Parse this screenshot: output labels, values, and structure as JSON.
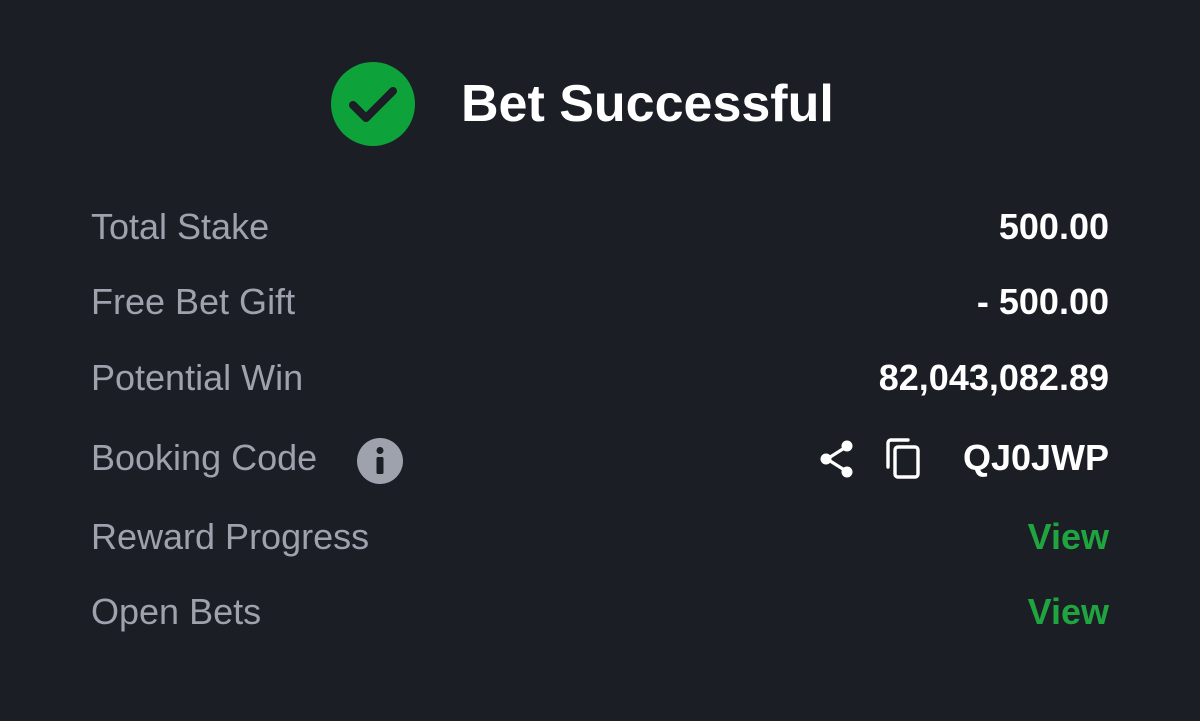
{
  "header": {
    "title": "Bet Successful",
    "icon": "check-circle-icon",
    "icon_color": "#0ea33a"
  },
  "summary": {
    "total_stake_label": "Total Stake",
    "total_stake_value": "500.00",
    "free_bet_label": "Free Bet Gift",
    "free_bet_value": "- 500.00",
    "potential_win_label": "Potential Win",
    "potential_win_value": "82,043,082.89",
    "booking_code_label": "Booking Code",
    "booking_code_value": "QJ0JWP",
    "reward_progress_label": "Reward Progress",
    "reward_progress_link": "View",
    "open_bets_label": "Open Bets",
    "open_bets_link": "View"
  },
  "icons": {
    "info": "info-icon",
    "share": "share-icon",
    "copy": "copy-icon"
  },
  "colors": {
    "background": "#1b1e25",
    "label": "#9ea2ad",
    "value": "#ffffff",
    "link": "#1fa43f"
  }
}
